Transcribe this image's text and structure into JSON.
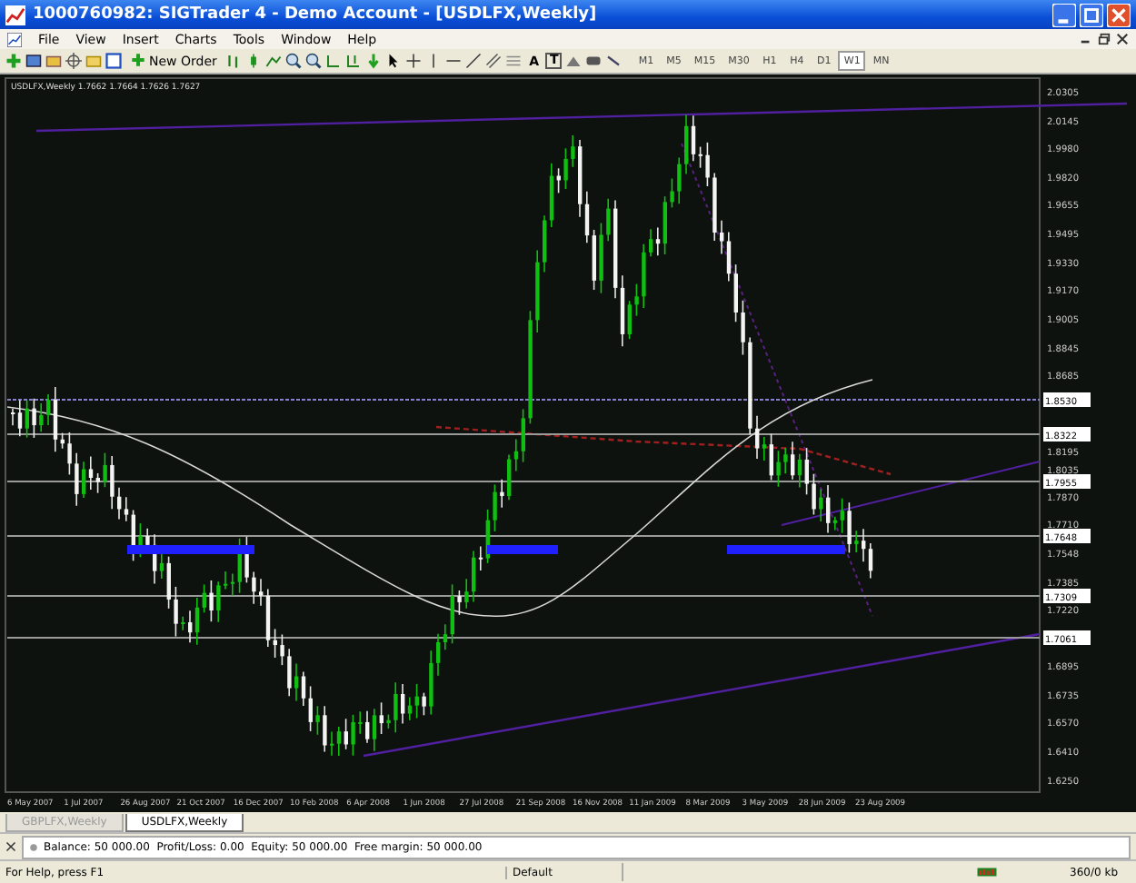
{
  "window": {
    "title": "1000760982: SIGTrader 4 - Demo Account - [USDLFX,Weekly]"
  },
  "menu": [
    "File",
    "View",
    "Insert",
    "Charts",
    "Tools",
    "Window",
    "Help"
  ],
  "toolbar": {
    "new_order": "New Order",
    "text_tools": [
      "A",
      "T"
    ],
    "timeframes": [
      {
        "label": "M1",
        "selected": false
      },
      {
        "label": "M5",
        "selected": false
      },
      {
        "label": "M15",
        "selected": false
      },
      {
        "label": "M30",
        "selected": false
      },
      {
        "label": "H1",
        "selected": false
      },
      {
        "label": "H4",
        "selected": false
      },
      {
        "label": "D1",
        "selected": false
      },
      {
        "label": "W1",
        "selected": true
      },
      {
        "label": "MN",
        "selected": false
      }
    ]
  },
  "chart": {
    "header": "USDLFX,Weekly  1.7662 1.7664 1.7626 1.7627",
    "price_axis": [
      {
        "label": "2.0305",
        "kind": "tick"
      },
      {
        "label": "2.0145",
        "kind": "tick"
      },
      {
        "label": "1.9980",
        "kind": "tick"
      },
      {
        "label": "1.9820",
        "kind": "tick"
      },
      {
        "label": "1.9655",
        "kind": "tick"
      },
      {
        "label": "1.9495",
        "kind": "tick"
      },
      {
        "label": "1.9330",
        "kind": "tick"
      },
      {
        "label": "1.9170",
        "kind": "tick"
      },
      {
        "label": "1.9005",
        "kind": "tick"
      },
      {
        "label": "1.8845",
        "kind": "tick"
      },
      {
        "label": "1.8685",
        "kind": "tick"
      },
      {
        "label": "1.8530",
        "kind": "level"
      },
      {
        "label": "1.8322",
        "kind": "level"
      },
      {
        "label": "1.8195",
        "kind": "tick"
      },
      {
        "label": "1.8035",
        "kind": "tick"
      },
      {
        "label": "1.7955",
        "kind": "level"
      },
      {
        "label": "1.7870",
        "kind": "tick"
      },
      {
        "label": "1.7710",
        "kind": "tick"
      },
      {
        "label": "1.7648",
        "kind": "level"
      },
      {
        "label": "1.7548",
        "kind": "tick"
      },
      {
        "label": "1.7385",
        "kind": "tick"
      },
      {
        "label": "1.7309",
        "kind": "level"
      },
      {
        "label": "1.7220",
        "kind": "tick"
      },
      {
        "label": "1.7061",
        "kind": "level"
      },
      {
        "label": "1.6895",
        "kind": "tick"
      },
      {
        "label": "1.6735",
        "kind": "tick"
      },
      {
        "label": "1.6570",
        "kind": "tick"
      },
      {
        "label": "1.6410",
        "kind": "tick"
      },
      {
        "label": "1.6250",
        "kind": "tick"
      }
    ],
    "time_axis": [
      "6 May 2007",
      "1 Jul 2007",
      "26 Aug 2007",
      "21 Oct 2007",
      "16 Dec 2007",
      "10 Feb 2008",
      "6 Apr 2008",
      "1 Jun 2008",
      "27 Jul 2008",
      "21 Sep 2008",
      "16 Nov 2008",
      "11 Jan 2009",
      "8 Mar 2009",
      "3 May 2009",
      "28 Jun 2009",
      "23 Aug 2009"
    ]
  },
  "chart_tabs": [
    {
      "label": "GBPLFX,Weekly",
      "selected": false
    },
    {
      "label": "USDLFX,Weekly",
      "selected": true
    }
  ],
  "terminal": {
    "summary": "Balance: 50 000.00  Profit/Loss: 0.00  Equity: 50 000.00  Free margin: 50 000.00"
  },
  "status_bar": {
    "help": "For Help, press F1",
    "profile": "Default",
    "traffic": "360/0 kb"
  }
}
